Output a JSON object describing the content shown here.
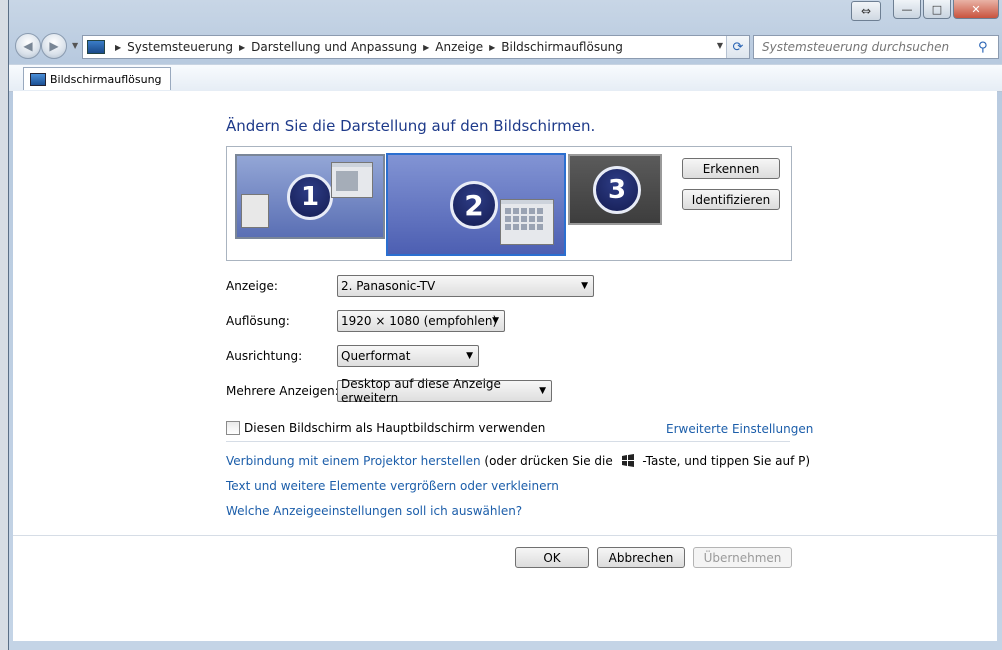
{
  "window": {
    "controls": {
      "minimize": "—",
      "maximize": "□",
      "close": "✕"
    }
  },
  "navigation": {
    "back_icon": "arrow-left-icon",
    "forward_icon": "arrow-right-icon",
    "breadcrumb": [
      "Systemsteuerung",
      "Darstellung und Anpassung",
      "Anzeige",
      "Bildschirmauflösung"
    ],
    "search_placeholder": "Systemsteuerung durchsuchen"
  },
  "tab": {
    "label": "Bildschirmauflösung"
  },
  "page": {
    "title": "Ändern Sie die Darstellung auf den Bildschirmen.",
    "monitors": [
      "1",
      "2",
      "3"
    ],
    "detect_button": "Erkennen",
    "identify_button": "Identifizieren"
  },
  "form": {
    "display_label": "Anzeige:",
    "display_value": "2. Panasonic-TV",
    "resolution_label": "Auflösung:",
    "resolution_value": "1920 × 1080 (empfohlen)",
    "orientation_label": "Ausrichtung:",
    "orientation_value": "Querformat",
    "multiple_label": "Mehrere Anzeigen:",
    "multiple_value": "Desktop auf diese Anzeige erweitern"
  },
  "options": {
    "primary_checkbox_label": "Diesen Bildschirm als Hauptbildschirm verwenden",
    "primary_checked": false,
    "advanced_link": "Erweiterte Einstellungen"
  },
  "links": {
    "projector_link": "Verbindung mit einem Projektor herstellen",
    "projector_hint_prefix": "(oder drücken Sie die",
    "projector_hint_suffix": "-Taste, und tippen Sie auf P)",
    "text_size_link": "Text und weitere Elemente vergrößern oder verkleinern",
    "which_settings_link": "Welche Anzeigeeinstellungen soll ich auswählen?"
  },
  "buttons": {
    "ok": "OK",
    "cancel": "Abbrechen",
    "apply": "Übernehmen"
  }
}
